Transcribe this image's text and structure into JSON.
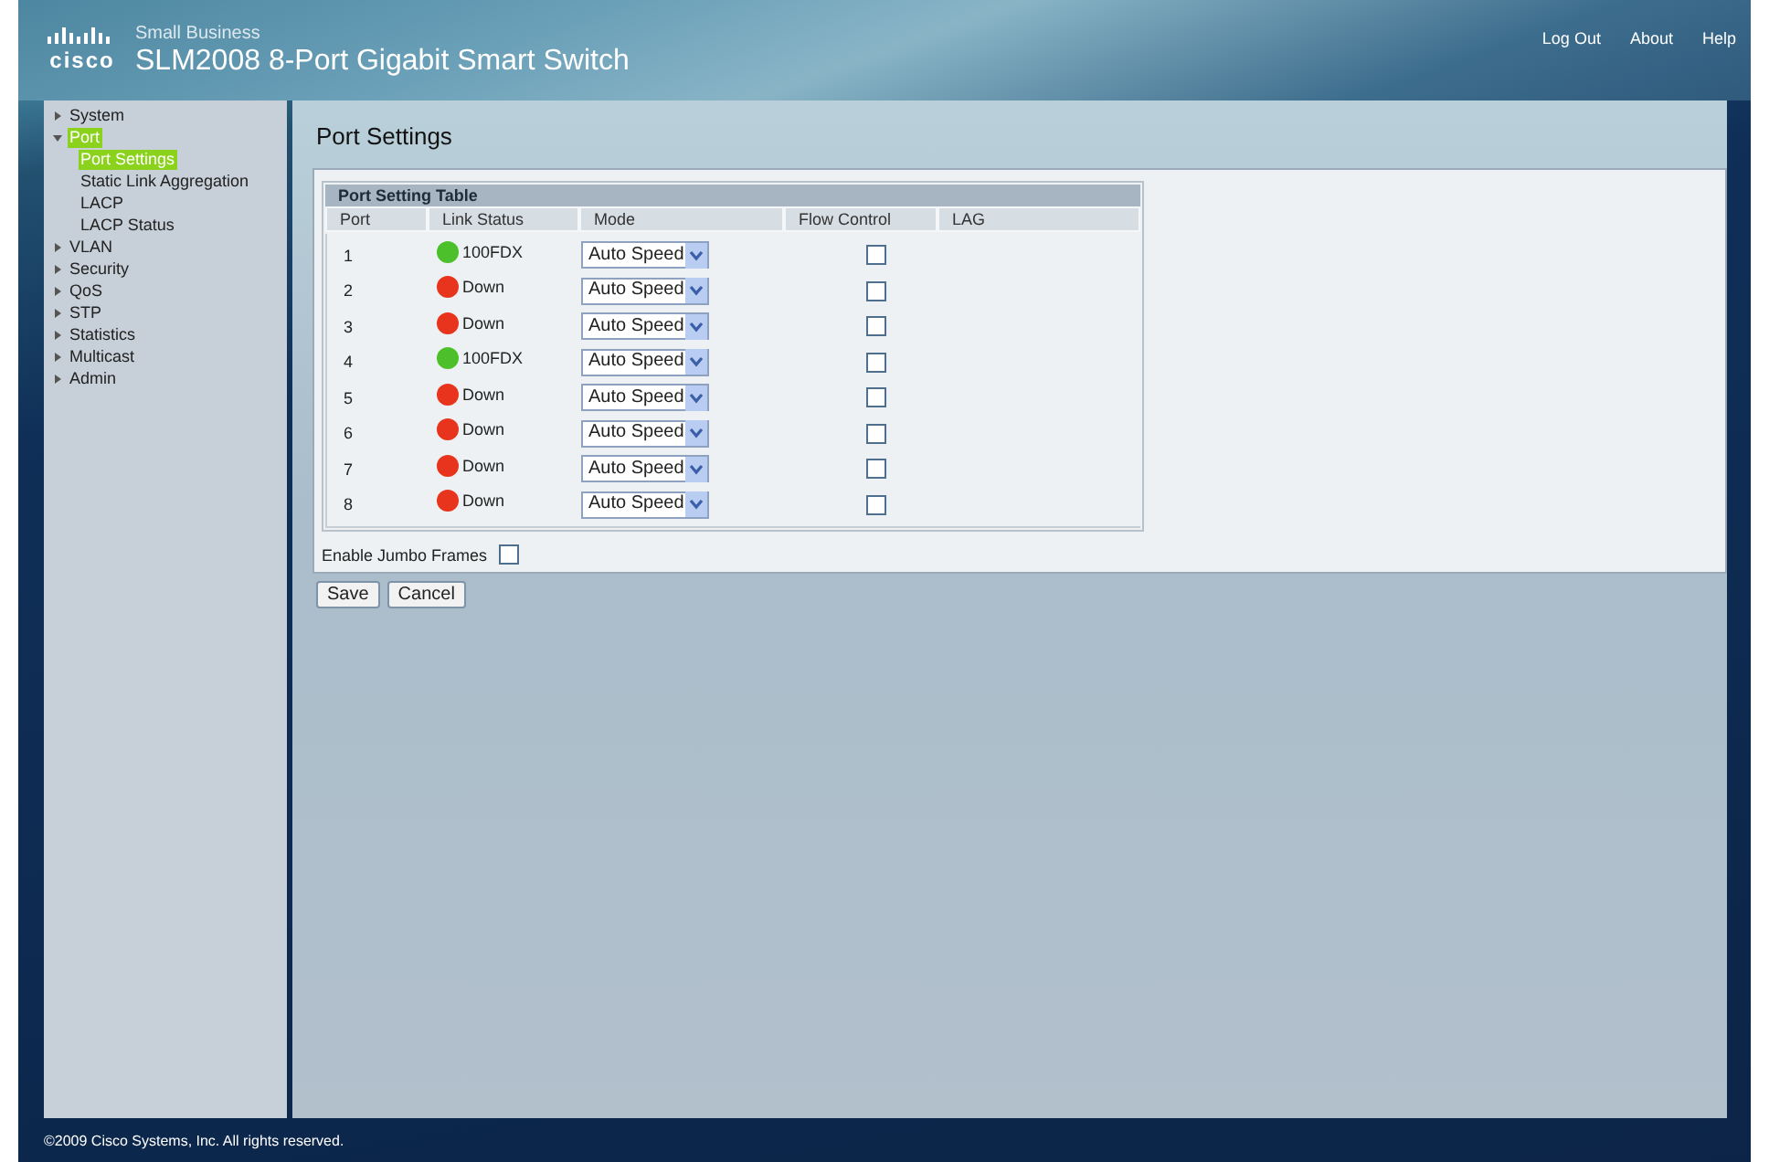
{
  "header": {
    "logo_text": "cisco",
    "subtitle": "Small Business",
    "title": "SLM2008 8-Port Gigabit Smart Switch",
    "links": [
      "Log Out",
      "About",
      "Help"
    ]
  },
  "sidebar": {
    "items": [
      {
        "label": "System",
        "expanded": false,
        "selected": false
      },
      {
        "label": "Port",
        "expanded": true,
        "selected": true,
        "children": [
          {
            "label": "Port Settings",
            "selected": true
          },
          {
            "label": "Static Link Aggregation",
            "selected": false
          },
          {
            "label": "LACP",
            "selected": false
          },
          {
            "label": "LACP Status",
            "selected": false
          }
        ]
      },
      {
        "label": "VLAN",
        "expanded": false,
        "selected": false
      },
      {
        "label": "Security",
        "expanded": false,
        "selected": false
      },
      {
        "label": "QoS",
        "expanded": false,
        "selected": false
      },
      {
        "label": "STP",
        "expanded": false,
        "selected": false
      },
      {
        "label": "Statistics",
        "expanded": false,
        "selected": false
      },
      {
        "label": "Multicast",
        "expanded": false,
        "selected": false
      },
      {
        "label": "Admin",
        "expanded": false,
        "selected": false
      }
    ]
  },
  "page_title": "Port Settings",
  "table": {
    "title": "Port Setting Table",
    "columns": [
      "Port",
      "Link Status",
      "Mode",
      "Flow Control",
      "LAG"
    ],
    "rows": [
      {
        "port": "1",
        "color": "#4cc02a",
        "status": "100FDX",
        "mode": "Auto Speed",
        "flow_control": false
      },
      {
        "port": "2",
        "color": "#e8341c",
        "status": "Down",
        "mode": "Auto Speed",
        "flow_control": false
      },
      {
        "port": "3",
        "color": "#e8341c",
        "status": "Down",
        "mode": "Auto Speed",
        "flow_control": false
      },
      {
        "port": "4",
        "color": "#4cc02a",
        "status": "100FDX",
        "mode": "Auto Speed",
        "flow_control": false
      },
      {
        "port": "5",
        "color": "#e8341c",
        "status": "Down",
        "mode": "Auto Speed",
        "flow_control": false
      },
      {
        "port": "6",
        "color": "#e8341c",
        "status": "Down",
        "mode": "Auto Speed",
        "flow_control": false
      },
      {
        "port": "7",
        "color": "#e8341c",
        "status": "Down",
        "mode": "Auto Speed",
        "flow_control": false
      },
      {
        "port": "8",
        "color": "#e8341c",
        "status": "Down",
        "mode": "Auto Speed",
        "flow_control": false
      }
    ]
  },
  "jumbo": {
    "label": "Enable Jumbo Frames",
    "checked": false
  },
  "buttons": [
    "Save",
    "Cancel"
  ],
  "footer": "©2009 Cisco Systems, Inc. All rights reserved."
}
